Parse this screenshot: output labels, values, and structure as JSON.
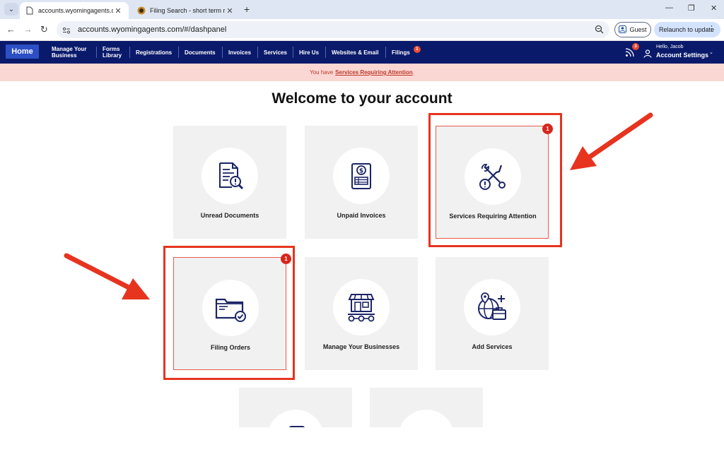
{
  "browser": {
    "tabs": [
      {
        "title": "accounts.wyomingagents.com/#",
        "active": true
      },
      {
        "title": "Filing Search - short term renta",
        "active": false
      }
    ],
    "url": "accounts.wyomingagents.com/#/dashpanel",
    "guest_label": "Guest",
    "relaunch_label": "Relaunch to update"
  },
  "nav": {
    "home": "Home",
    "items": [
      {
        "label": "Manage Your Business"
      },
      {
        "label": "Forms Library"
      },
      {
        "label": "Registrations"
      },
      {
        "label": "Documents"
      },
      {
        "label": "Invoices"
      },
      {
        "label": "Services"
      },
      {
        "label": "Hire Us"
      },
      {
        "label": "Websites & Email"
      },
      {
        "label": "Filings"
      }
    ],
    "filings_badge": "1",
    "rss_badge": "3",
    "greeting": "Hello, Jacob",
    "account_settings": "Account Settings"
  },
  "alert": {
    "prefix": "You have",
    "link": "Services Requiring Attention",
    "suffix": "."
  },
  "welcome": "Welcome to your account",
  "cards": [
    {
      "label": "Unread Documents",
      "icon": "document-search-icon"
    },
    {
      "label": "Unpaid Invoices",
      "icon": "invoice-dollar-icon"
    },
    {
      "label": "Services Requiring Attention",
      "icon": "tools-alert-icon",
      "badge": "1"
    },
    {
      "label": "Filing Orders",
      "icon": "folder-check-icon",
      "badge": "1"
    },
    {
      "label": "Manage Your Businesses",
      "icon": "storefront-icon"
    },
    {
      "label": "Add Services",
      "icon": "globe-briefcase-icon"
    }
  ],
  "colors": {
    "nav_bg": "#0a1a6b",
    "home_btn": "#2d4fc5",
    "alert_bg": "#fad7d3",
    "badge": "#d9261c",
    "highlight": "#e6341f",
    "icon": "#1b2466"
  }
}
